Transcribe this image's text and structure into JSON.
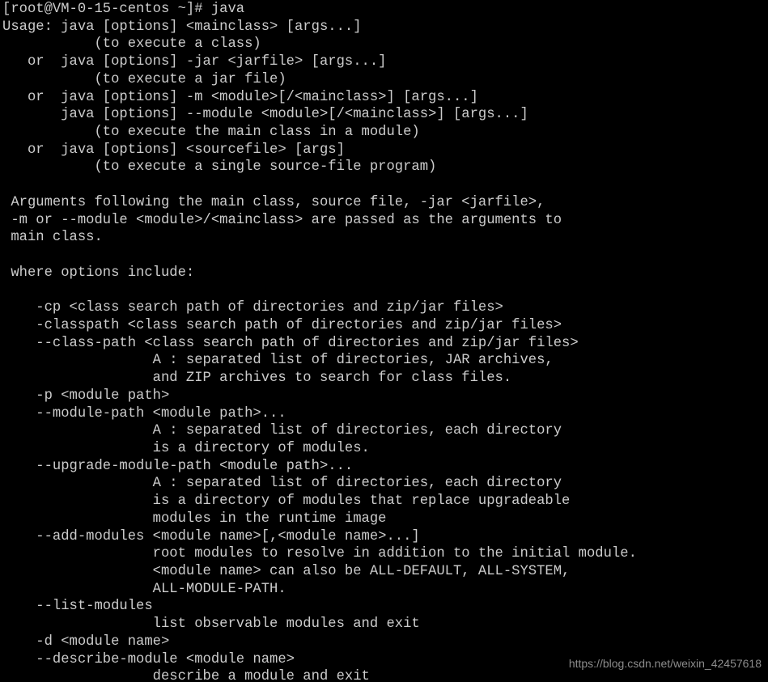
{
  "window": {
    "title": "root@VM-0-15-centos:~",
    "background_color": "#000000",
    "foreground_color": "#cccccc",
    "watermark_color": "#8c8c8c"
  },
  "terminal": {
    "prompt": "[root@VM-0-15-centos ~]#",
    "command": "java",
    "user": "root",
    "host": "VM-0-15-centos",
    "cwd": "~",
    "lines": [
      "[root@VM-0-15-centos ~]# java",
      "Usage: java [options] <mainclass> [args...]",
      "           (to execute a class)",
      "   or  java [options] -jar <jarfile> [args...]",
      "           (to execute a jar file)",
      "   or  java [options] -m <module>[/<mainclass>] [args...]",
      "       java [options] --module <module>[/<mainclass>] [args...]",
      "           (to execute the main class in a module)",
      "   or  java [options] <sourcefile> [args]",
      "           (to execute a single source-file program)",
      "",
      " Arguments following the main class, source file, -jar <jarfile>,",
      " -m or --module <module>/<mainclass> are passed as the arguments to",
      " main class.",
      "",
      " where options include:",
      "",
      "    -cp <class search path of directories and zip/jar files>",
      "    -classpath <class search path of directories and zip/jar files>",
      "    --class-path <class search path of directories and zip/jar files>",
      "                  A : separated list of directories, JAR archives,",
      "                  and ZIP archives to search for class files.",
      "    -p <module path>",
      "    --module-path <module path>...",
      "                  A : separated list of directories, each directory",
      "                  is a directory of modules.",
      "    --upgrade-module-path <module path>...",
      "                  A : separated list of directories, each directory",
      "                  is a directory of modules that replace upgradeable",
      "                  modules in the runtime image",
      "    --add-modules <module name>[,<module name>...]",
      "                  root modules to resolve in addition to the initial module.",
      "                  <module name> can also be ALL-DEFAULT, ALL-SYSTEM,",
      "                  ALL-MODULE-PATH.",
      "    --list-modules",
      "                  list observable modules and exit",
      "    -d <module name>",
      "    --describe-module <module name>",
      "                  describe a module and exit"
    ]
  },
  "watermark": {
    "text": "https://blog.csdn.net/weixin_42457618"
  }
}
